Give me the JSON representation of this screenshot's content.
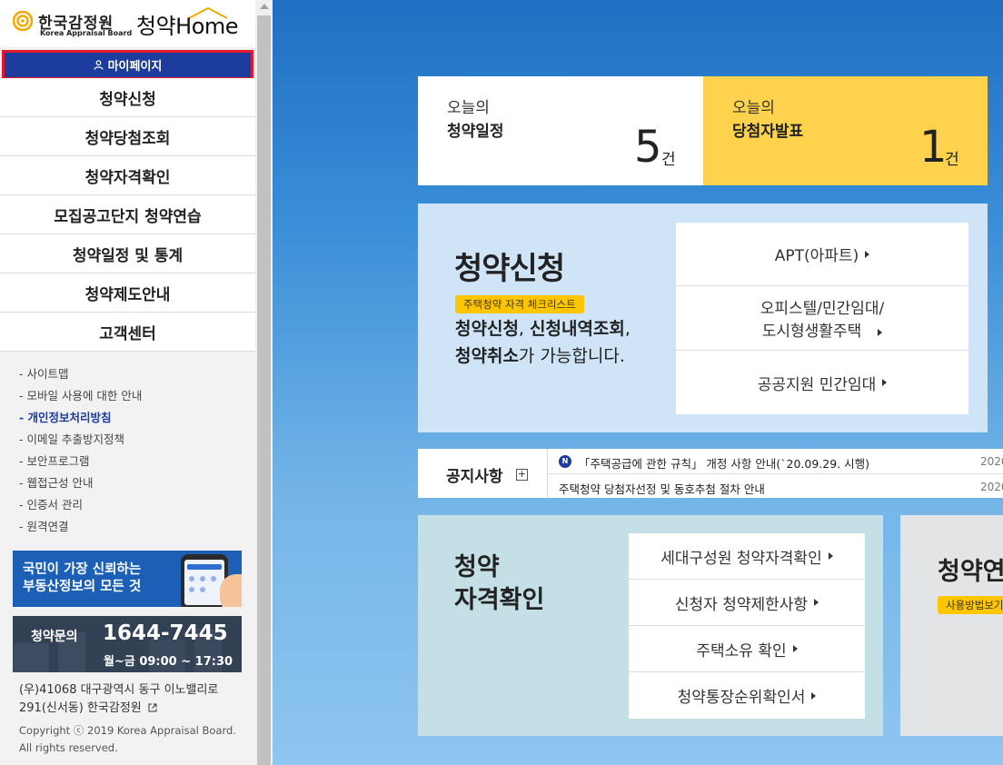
{
  "logo": {
    "korean": "한국감정원",
    "english": "Korea Appraisal Board",
    "service": "청약Home",
    "brand_color": "#f5a800"
  },
  "sidebar": {
    "mypage": "마이페이지",
    "menu": [
      {
        "label": "청약신청"
      },
      {
        "label": "청약당첨조회"
      },
      {
        "label": "청약자격확인"
      },
      {
        "label": "모집공고단지 청약연습"
      },
      {
        "label": "청약일정 및 통계"
      },
      {
        "label": "청약제도안내"
      },
      {
        "label": "고객센터"
      }
    ],
    "sublinks": [
      {
        "label": "- 사이트맵"
      },
      {
        "label": "- 모바일 사용에 대한 안내"
      },
      {
        "label": "- 개인정보처리방침"
      },
      {
        "label": "- 이메일 추출방지정책"
      },
      {
        "label": "- 보안프로그램"
      },
      {
        "label": "- 웹접근성 안내"
      },
      {
        "label": "- 인증서 관리"
      },
      {
        "label": "- 원격연결"
      }
    ],
    "banner_real_estate": {
      "line1": "국민이 가장 신뢰하는",
      "line2": "부동산정보의 모든 것"
    },
    "banner_contact": {
      "label": "청약문의",
      "phone": "1644-7445",
      "hours": "월~금 09:00 ~ 17:30"
    },
    "address": {
      "line1": "(우)41068 대구광역시 동구 이노밸리로",
      "line2": "291(신서동) 한국감정원"
    },
    "copyright": {
      "line1": "Copyright ⓒ 2019 Korea Appraisal Board.",
      "line2": "All rights reserved."
    }
  },
  "today": {
    "schedule": {
      "line1": "오늘의",
      "line2": "청약일정",
      "count": "5",
      "unit": "건"
    },
    "winners": {
      "line1": "오늘의",
      "line2": "당첨자발표",
      "count": "1",
      "unit": "건"
    }
  },
  "apply": {
    "title": "청약신청",
    "badge": "주택청약 자격 체크리스트",
    "desc_bold1": "청약신청",
    "desc_sep1": ", ",
    "desc_bold2": "신청내역조회",
    "desc_sep2": ",",
    "desc_bold3": "청약취소",
    "desc_tail": "가 가능합니다.",
    "links": [
      {
        "label": "APT(아파트)"
      },
      {
        "line1": "오피스텔/민간임대/",
        "line2": "도시형생활주택"
      },
      {
        "label": "공공지원 민간임대"
      }
    ]
  },
  "notice": {
    "title": "공지사항",
    "plus": "+",
    "items": [
      {
        "badge": "N",
        "text": "「주택공급에 관한 규칙」 개정 사항 안내(`20.09.29. 시행)",
        "date": "2020"
      },
      {
        "text": "주택청약 당첨자선정 및 동호추첨 절차 안내",
        "date": "2020"
      }
    ]
  },
  "qualification": {
    "title_line1": "청약",
    "title_line2": "자격확인",
    "links": [
      {
        "label": "세대구성원 청약자격확인"
      },
      {
        "label": "신청자 청약제한사항"
      },
      {
        "label": "주택소유 확인"
      },
      {
        "label": "청약통장순위확인서"
      }
    ]
  },
  "howto": {
    "title": "청약연",
    "badge": "사용방법보기"
  },
  "colors": {
    "nav_blue": "#1c3d9e",
    "highlight_red": "#e3182d",
    "yellow": "#ffd24d",
    "badge_yellow": "#ffc600"
  }
}
